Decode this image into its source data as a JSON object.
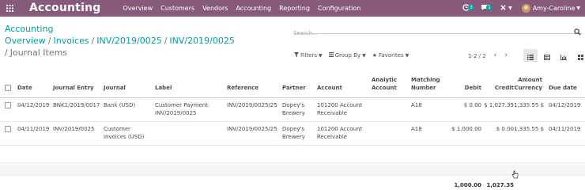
{
  "navbar": {
    "brand": "Accounting",
    "menu": [
      "Overview",
      "Customers",
      "Vendors",
      "Accounting",
      "Reporting",
      "Configuration"
    ],
    "activity_badge": "3",
    "messages_badge": "1",
    "user_name": "Amy-Caroline",
    "colors": {
      "bar": "#875a7b",
      "badge": "#00a09d"
    }
  },
  "breadcrumb": {
    "items": [
      "Accounting Overview",
      "Invoices",
      "INV/2019/0025",
      "INV/2019/0025"
    ],
    "current": "Journal Items"
  },
  "search": {
    "placeholder": "Search..."
  },
  "filters": {
    "filters_label": "Filters",
    "group_by_label": "Group By",
    "favorites_label": "Favorites"
  },
  "pager": {
    "value": "1-2 / 2"
  },
  "table": {
    "headers": {
      "date": "Date",
      "journal_entry": "Journal Entry",
      "journal": "Journal",
      "label": "Label",
      "reference": "Reference",
      "partner": "Partner",
      "account": "Account",
      "analytic_1": "Analytic",
      "analytic_2": "Account",
      "matching_1": "Matching",
      "matching_2": "Number",
      "debit": "Debit",
      "credit": "Credit",
      "amount_currency_1": "Amount",
      "amount_currency_2": "Currency",
      "due_date": "Due date"
    },
    "rows": [
      {
        "date": "04/12/2019",
        "journal_entry": "BNK1/2019/0017",
        "journal": "Bank (USD)",
        "label_1": "Customer Payment:",
        "label_2": "INV/2019/0025",
        "reference": "INV/2019/0025/25",
        "partner_1": "Dopey's",
        "partner_2": "Brewery",
        "account_1": "101200 Account",
        "account_2": "Receivable",
        "analytic": "",
        "matching": "A18",
        "debit": "$ 0.00",
        "credit": "$ 1,027.35",
        "amount_currency": "-1,335.55 $",
        "due_date": "04/12/2019"
      },
      {
        "date": "04/11/2019",
        "journal_entry": "INV/2019/0025",
        "journal_1": "Customer",
        "journal_2": "Invoices (USD)",
        "reference": "INV/2019/0025/25",
        "partner_1": "Dopey's",
        "partner_2": "Brewery",
        "account_1": "101200 Account",
        "account_2": "Receivable",
        "analytic": "",
        "matching": "A18",
        "debit": "$ 1,000.00",
        "credit": "$ 0.00",
        "amount_currency": "1,335.55 $",
        "due_date": "04/11/2019"
      }
    ],
    "totals": {
      "debit": "1,000.00",
      "credit": "1,027.35"
    }
  }
}
